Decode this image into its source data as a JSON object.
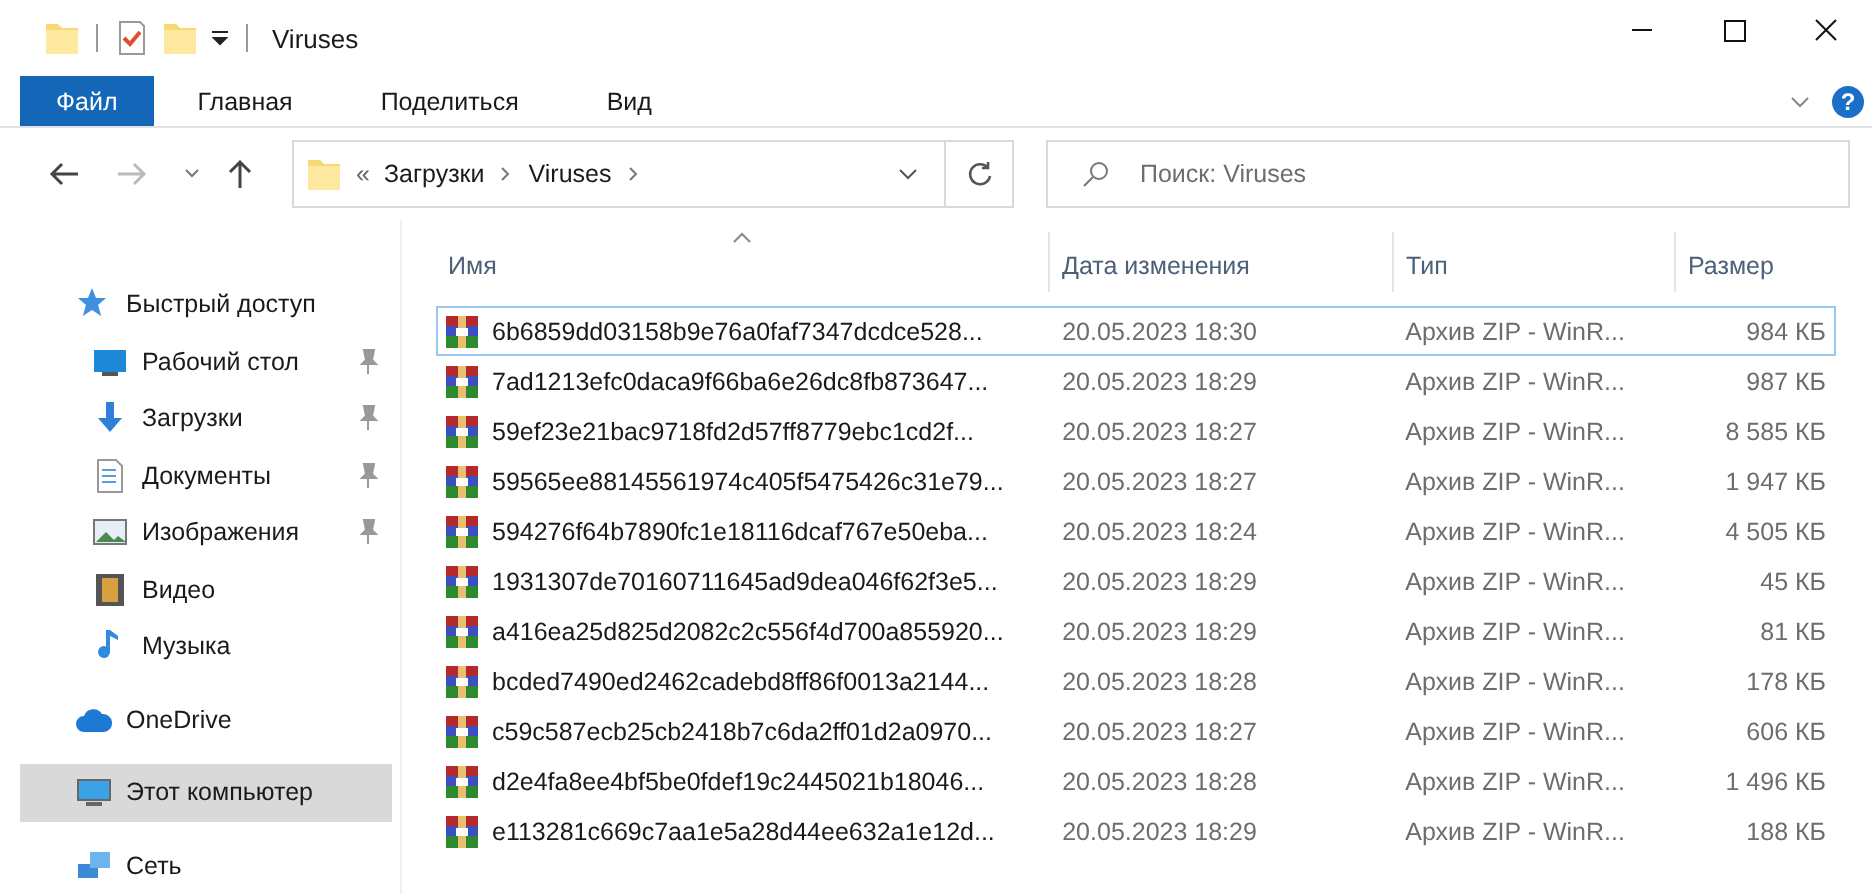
{
  "window": {
    "title": "Viruses"
  },
  "ribbon": {
    "tabs": [
      {
        "label": "Файл",
        "selected": true
      },
      {
        "label": "Главная",
        "selected": false
      },
      {
        "label": "Поделиться",
        "selected": false
      },
      {
        "label": "Вид",
        "selected": false
      }
    ],
    "help": "?"
  },
  "address": {
    "overflow": "«",
    "crumbs": [
      "Загрузки",
      "Viruses"
    ]
  },
  "search": {
    "placeholder": "Поиск: Viruses"
  },
  "sidebar": {
    "items": [
      {
        "label": "Быстрый доступ",
        "kind": "star",
        "selected": false,
        "children": [
          {
            "label": "Рабочий стол",
            "kind": "desktop",
            "pinned": true,
            "selected": false
          },
          {
            "label": "Загрузки",
            "kind": "download",
            "pinned": true,
            "selected": false
          },
          {
            "label": "Документы",
            "kind": "document",
            "pinned": true,
            "selected": false
          },
          {
            "label": "Изображения",
            "kind": "image",
            "pinned": true,
            "selected": false
          },
          {
            "label": "Видео",
            "kind": "film",
            "pinned": false,
            "selected": false
          },
          {
            "label": "Музыка",
            "kind": "note",
            "pinned": false,
            "selected": false
          }
        ]
      },
      {
        "label": "OneDrive",
        "kind": "cloud",
        "selected": false
      },
      {
        "label": "Этот компьютер",
        "kind": "monitor",
        "selected": true
      },
      {
        "label": "Сеть",
        "kind": "network",
        "selected": false
      }
    ]
  },
  "table": {
    "columns": [
      {
        "label": "Имя",
        "sorted": true
      },
      {
        "label": "Дата изменения",
        "sorted": false
      },
      {
        "label": "Тип",
        "sorted": false
      },
      {
        "label": "Размер",
        "sorted": false
      }
    ],
    "rows": [
      {
        "focused": true,
        "cells": [
          "6b6859dd03158b9e76a0faf7347dcdce528...",
          "20.05.2023 18:30",
          "Архив ZIP - WinR...",
          "984 КБ"
        ]
      },
      {
        "focused": false,
        "cells": [
          "7ad1213efc0daca9f66ba6e26dc8fb873647...",
          "20.05.2023 18:29",
          "Архив ZIP - WinR...",
          "987 КБ"
        ]
      },
      {
        "focused": false,
        "cells": [
          "59ef23e21bac9718fd2d57ff8779ebc1cd2f...",
          "20.05.2023 18:27",
          "Архив ZIP - WinR...",
          "8 585 КБ"
        ]
      },
      {
        "focused": false,
        "cells": [
          "59565ee88145561974c405f5475426c31e79...",
          "20.05.2023 18:27",
          "Архив ZIP - WinR...",
          "1 947 КБ"
        ]
      },
      {
        "focused": false,
        "cells": [
          "594276f64b7890fc1e18116dcaf767e50eba...",
          "20.05.2023 18:24",
          "Архив ZIP - WinR...",
          "4 505 КБ"
        ]
      },
      {
        "focused": false,
        "cells": [
          "1931307de70160711645ad9dea046f62f3e5...",
          "20.05.2023 18:29",
          "Архив ZIP - WinR...",
          "45 КБ"
        ]
      },
      {
        "focused": false,
        "cells": [
          "a416ea25d825d2082c2c556f4d700a855920...",
          "20.05.2023 18:29",
          "Архив ZIP - WinR...",
          "81 КБ"
        ]
      },
      {
        "focused": false,
        "cells": [
          "bcded7490ed2462cadebd8ff86f0013a2144...",
          "20.05.2023 18:28",
          "Архив ZIP - WinR...",
          "178 КБ"
        ]
      },
      {
        "focused": false,
        "cells": [
          "c59c587ecb25cb2418b7c6da2ff01d2a0970...",
          "20.05.2023 18:27",
          "Архив ZIP - WinR...",
          "606 КБ"
        ]
      },
      {
        "focused": false,
        "cells": [
          "d2e4fa8ee4bf5be0fdef19c2445021b18046...",
          "20.05.2023 18:28",
          "Архив ZIP - WinR...",
          "1 496 КБ"
        ]
      },
      {
        "focused": false,
        "cells": [
          "e113281c669c7aa1e5a28d44ee632a1e12d...",
          "20.05.2023 18:29",
          "Архив ZIP - WinR...",
          "188 КБ"
        ]
      }
    ]
  }
}
